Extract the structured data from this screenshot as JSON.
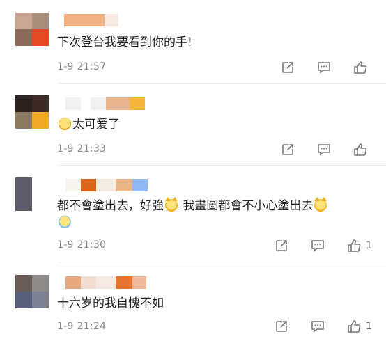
{
  "comments": [
    {
      "avatar_colors": [
        "#c9a593",
        "#a68e7c",
        "#8c6b5a",
        "#e34a26"
      ],
      "name_blocks": [
        "#f2b183",
        "#f6e9df"
      ],
      "text": "下次登台我要看到你的手!",
      "time": "1-9 21:57",
      "likes": ""
    },
    {
      "avatar_colors": [
        "#2b211e",
        "#3b2a25",
        "#8c7a63",
        "#f0a829"
      ],
      "name_blocks": [
        "#f0f0f0",
        "#e8b48f",
        "#f5b73b"
      ],
      "text": "太可爱了",
      "time": "1-9 21:33",
      "likes": ""
    },
    {
      "avatar_colors": [
        "#5e5b6b"
      ],
      "name_blocks": [
        "#f7f3ee",
        "#d9661a",
        "#f3ece3",
        "#e9b689",
        "#8fb9f0"
      ],
      "text_line1": "都不會塗出去，好強",
      "text_line1b": " 我畫圖都會不小心塗出去",
      "time": "1-9 21:30",
      "likes": "1"
    },
    {
      "avatar_colors": [
        "#6b5d56",
        "#8e8a89",
        "#56607a",
        "#7d8091"
      ],
      "name_blocks": [
        "#e9a97e",
        "#f3ddd0",
        "#f5eae4",
        "#e8732e",
        "#f0b89a"
      ],
      "text": "十六岁的我自愧不如",
      "time": "1-9 21:24",
      "likes": "1"
    }
  ],
  "icons": {
    "share": "share-icon",
    "comment": "comment-icon",
    "like": "thumbs-up-icon"
  }
}
